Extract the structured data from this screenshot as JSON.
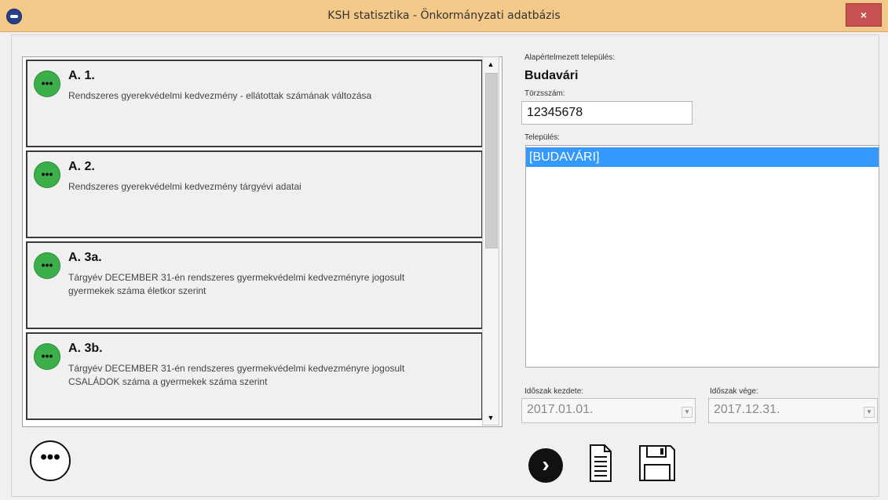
{
  "window": {
    "title": "KSH statisztika - Önkormányzati adatbázis",
    "close_label": "×"
  },
  "reports": [
    {
      "code": "A. 1.",
      "description": " Rendszeres gyerekvédelmi kedvezmény - ellátottak számának változása",
      "icon": "more-icon"
    },
    {
      "code": "A. 2.",
      "description": "Rendszeres gyerekvédelmi kedvezmény tárgyévi adatai",
      "icon": "more-icon"
    },
    {
      "code": "A. 3a.",
      "description": "Tárgyév DECEMBER 31-én rendszeres gyermekvédelmi kedvezményre jogosult gyermekek száma életkor szerint",
      "icon": "more-icon"
    },
    {
      "code": "A. 3b.",
      "description": "Tárgyév DECEMBER 31-én rendszeres gyermekvédelmi kedvezményre jogosult CSALÁDOK száma a gyermekek száma szerint",
      "icon": "more-icon"
    }
  ],
  "icons": {
    "card_icon": "•••",
    "more_button": "•••",
    "next_button": "›",
    "scroll_up": "▲",
    "scroll_down": "▼",
    "dropdown": "▼"
  },
  "default_settlement": {
    "label": "Alapértelmezett település:",
    "value": "Budavári"
  },
  "registry": {
    "label": "Törzsszám:",
    "value": "12345678"
  },
  "settlement": {
    "label": "Település:",
    "options": [
      "[BUDAVÁRI]"
    ],
    "selected": "[BUDAVÁRI]"
  },
  "period": {
    "start_label": "Időszak kezdete:",
    "start_value": "2017.01.01.",
    "end_label": "Időszak vége:",
    "end_value": "2017.12.31."
  },
  "colors": {
    "titlebar": "#f3c989",
    "card_icon": "#3cae4a",
    "selection": "#3399ff",
    "close": "#c75050"
  }
}
